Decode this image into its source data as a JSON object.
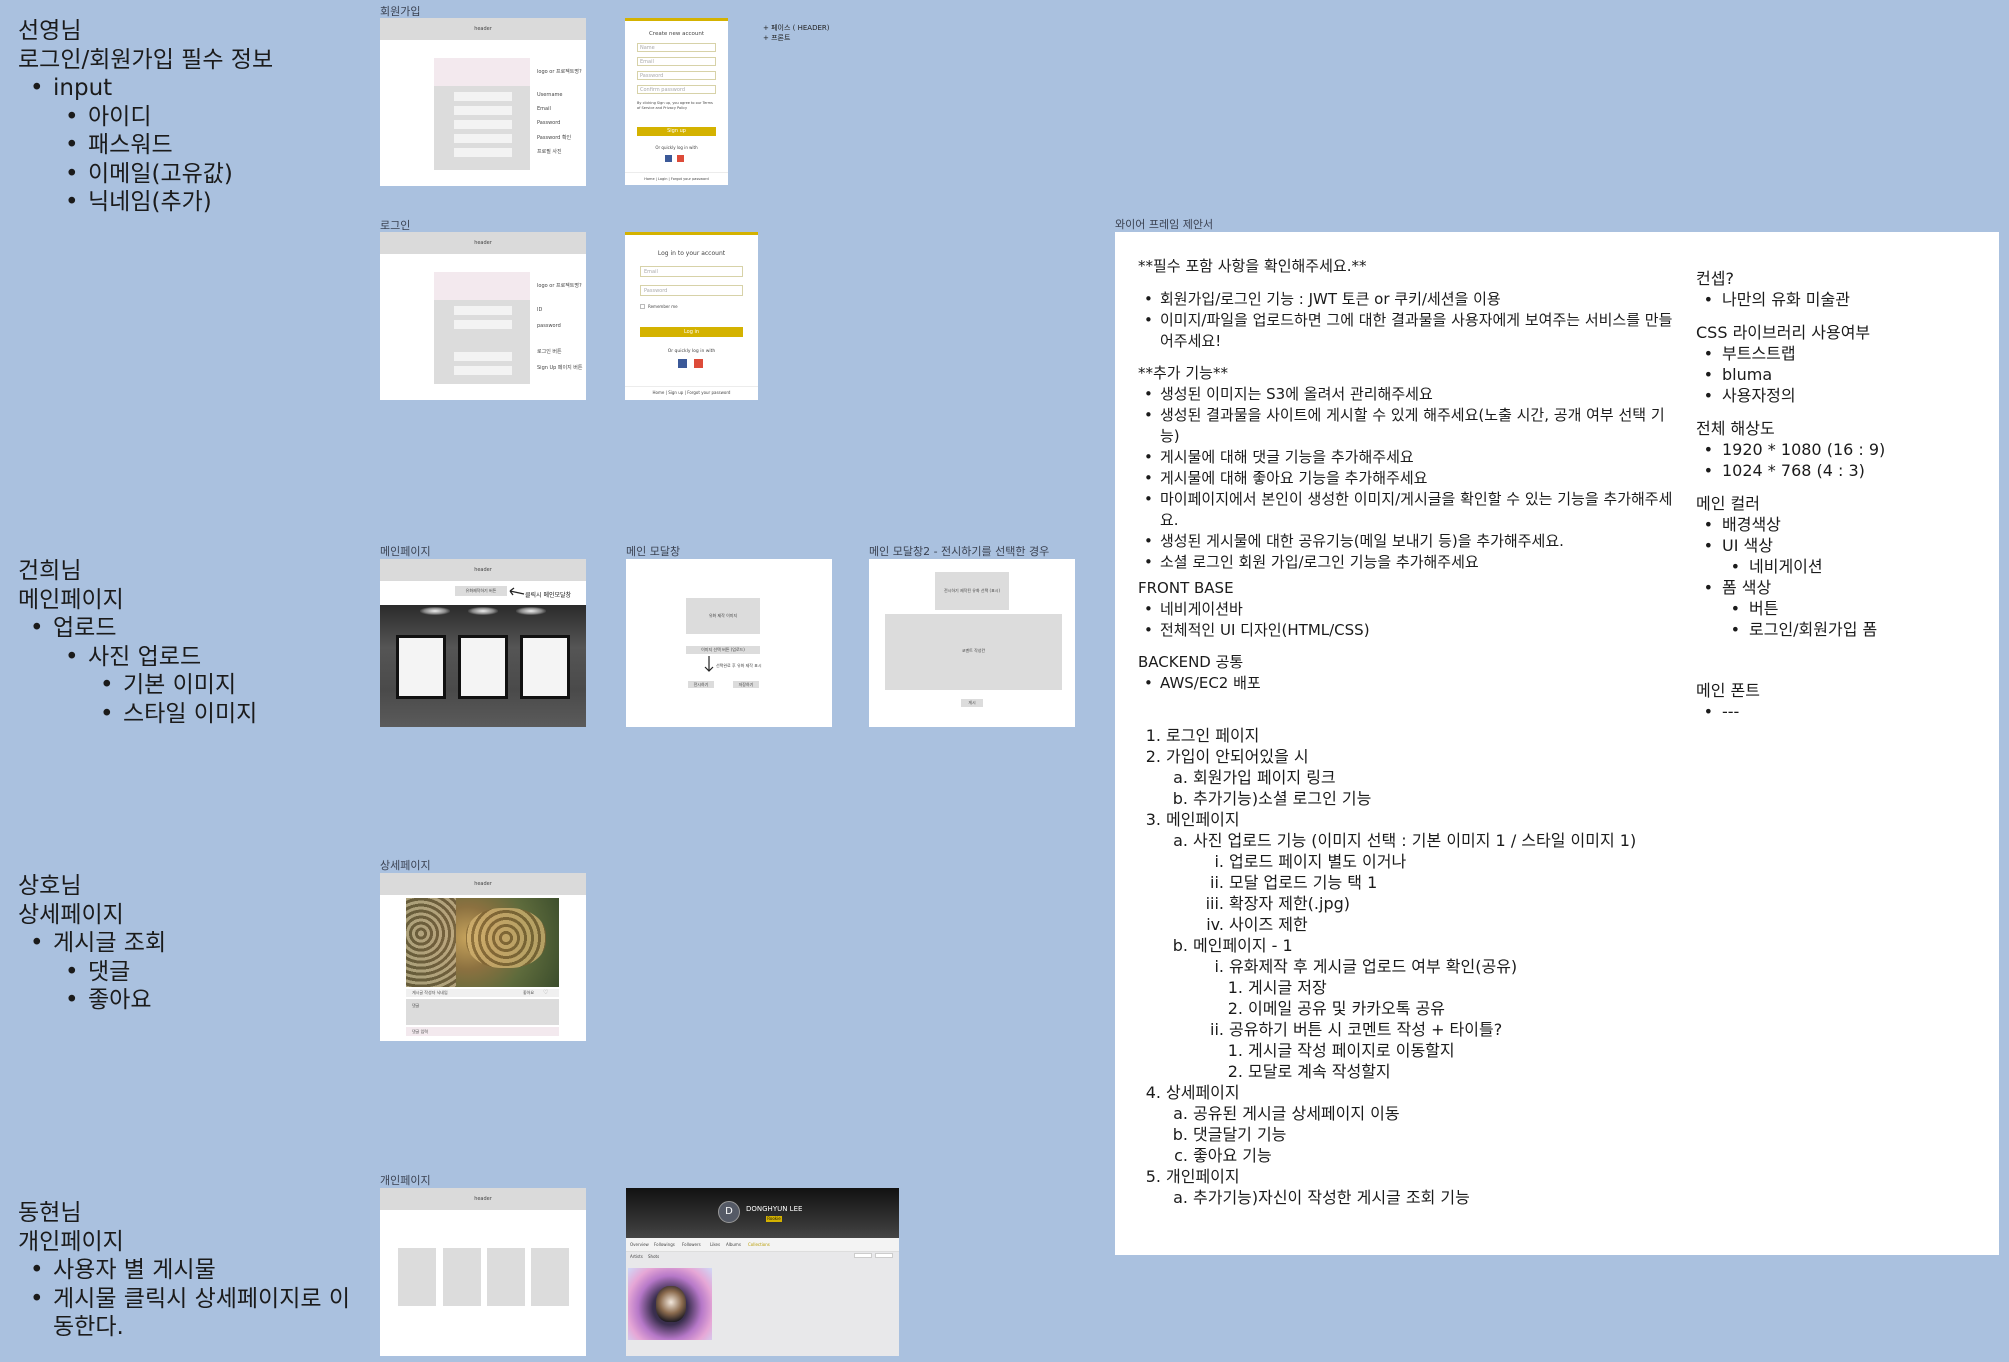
{
  "notes": [
    {
      "name": "선영님",
      "title": "로그인/회원가입 필수 정보",
      "items": [
        {
          "text": "input",
          "children": [
            {
              "text": "아이디"
            },
            {
              "text": "패스워드"
            },
            {
              "text": "이메일(고유값)"
            },
            {
              "text": "닉네임(추가)"
            }
          ]
        }
      ]
    },
    {
      "name": "건희님",
      "title": "메인페이지",
      "items": [
        {
          "text": "업로드",
          "children": [
            {
              "text": "사진 업로드",
              "children": [
                {
                  "text": "기본 이미지"
                },
                {
                  "text": "스타일 이미지"
                }
              ]
            }
          ]
        }
      ]
    },
    {
      "name": "상호님",
      "title": "상세페이지",
      "items": [
        {
          "text": "게시글 조회",
          "children": [
            {
              "text": "댓글"
            },
            {
              "text": "좋아요"
            }
          ]
        }
      ]
    },
    {
      "name": "동현님",
      "title": "개인페이지",
      "items": [
        {
          "text": "사용자 별 게시물"
        },
        {
          "text": "게시물 클릭시 상세페이지로 이동한다."
        }
      ]
    }
  ],
  "frames": {
    "signup": {
      "label": "회원가입",
      "header": "header",
      "side_q": "logo or 프로젝트명?",
      "fields": [
        "Username",
        "Email",
        "Password",
        "Password 확인",
        "프로필 사진"
      ],
      "ref_title": "Create new account",
      "ref_fields": [
        "Name",
        "Email",
        "Password",
        "Confirm password"
      ],
      "ref_terms": "By clicking Sign up, you agree to our Terms of Service and Privacy Policy",
      "ref_button": "Sign up",
      "ref_social": "Or quickly log in with",
      "ref_footer": "Home | Login | Forgot your password"
    },
    "signup_note": [
      "+ 페이스 ( HEADER)",
      "+ 프론트"
    ],
    "login": {
      "label": "로그인",
      "header": "header",
      "side_q": "logo or 프로젝트명?",
      "fields": [
        "ID",
        "password"
      ],
      "links": [
        "로그인 버튼",
        "Sign Up 페이지 버튼"
      ],
      "ref_title": "Log in to your account",
      "ref_fields": [
        "Email",
        "Password"
      ],
      "ref_remember": "Remember me",
      "ref_button": "Log in",
      "ref_social": "Or quickly log in with",
      "ref_footer": "Home | Sign up | Forgot your password"
    },
    "main": {
      "label": "메인페이지",
      "header": "header",
      "upload_button": "유화제작하기 버튼",
      "annotation": "클릭시 메인모달창"
    },
    "modal1": {
      "label": "메인 모달창",
      "box": "유화 제작 이미지",
      "pick": "이미지 선택 버튼 (업로드)",
      "arrow_note": "선택완료 후 유화 제작 표시",
      "btn1": "전시하기",
      "btn2": "저장하기"
    },
    "modal2": {
      "label": "메인 모달창2 - 전시하기를 선택한 경우",
      "box1": "전시하기 제작된 유화 선택 (표시)",
      "box2": "코멘트 작성칸",
      "btn": "게시"
    },
    "detail": {
      "label": "상세페이지",
      "header": "header",
      "caption": "게시글 작성자 닉네임",
      "like": "좋아요",
      "comment": "댓글",
      "comment_input": "댓글 입력"
    },
    "personal": {
      "label": "개인페이지",
      "header": "header"
    },
    "profile": {
      "name": "DONGHYUN LEE",
      "initial": "D",
      "badge": "Rookie",
      "tabs": [
        "Overview",
        "Followings",
        "Followers",
        "Likes",
        "Albums",
        "Collections"
      ],
      "sub_tabs": [
        "Artists",
        "Shots"
      ]
    }
  },
  "doc": {
    "title": "와이어 프레임 제안서",
    "required_heading": "**필수 포함 사항을 확인해주세요.**",
    "required": [
      "회원가입/로그인 기능 : JWT 토큰 or 쿠키/세션을 이용",
      "이미지/파일을 업로드하면 그에 대한 결과물을 사용자에게 보여주는 서비스를 만들어주세요!"
    ],
    "extra_heading": "**추가 기능**",
    "extra": [
      "생성된 이미지는 S3에 올려서 관리해주세요",
      "생성된 결과물을 사이트에 게시할 수 있게 해주세요(노출 시간, 공개 여부 선택 기능)",
      "게시물에 대해 댓글 기능을 추가해주세요",
      "게시물에 대해 좋아요 기능을 추가해주세요",
      "마이페이지에서 본인이 생성한 이미지/게시글을 확인할 수 있는 기능을 추가해주세요.",
      "생성된 게시물에 대한 공유기능(메일 보내기 등)을 추가해주세요.",
      "소셜 로그인 회원 가입/로그인 기능을 추가해주세요"
    ],
    "front_heading": "FRONT BASE",
    "front": [
      "네비게이션바",
      "전체적인 UI 디자인(HTML/CSS)"
    ],
    "backend_heading": "BACKEND 공통",
    "backend": [
      "AWS/EC2 배포"
    ],
    "outline": [
      {
        "m": "1.",
        "t": "로그인 페이지",
        "d": 0
      },
      {
        "m": "2.",
        "t": "가입이 안되어있을 시",
        "d": 0
      },
      {
        "m": "a.",
        "t": "회원가입 페이지 링크",
        "d": 1
      },
      {
        "m": "b.",
        "t": "추가기능)소셜 로그인 기능",
        "d": 1
      },
      {
        "m": "3.",
        "t": "메인페이지",
        "d": 0
      },
      {
        "m": "a.",
        "t": "사진 업로드 기능 (이미지 선택 : 기본 이미지 1 / 스타일 이미지 1)",
        "d": 1
      },
      {
        "m": "i.",
        "t": "업로드 페이지 별도 이거나",
        "d": 2
      },
      {
        "m": "ii.",
        "t": "모달 업로드 기능 택 1",
        "d": 2
      },
      {
        "m": "iii.",
        "t": "확장자 제한(.jpg)",
        "d": 2
      },
      {
        "m": "iv.",
        "t": "사이즈 제한",
        "d": 2
      },
      {
        "m": "b.",
        "t": "메인페이지 - 1",
        "d": 1
      },
      {
        "m": "i.",
        "t": "유화제작 후 게시글 업로드 여부 확인(공유)",
        "d": 2
      },
      {
        "m": "1.",
        "t": "게시글 저장",
        "d": 3
      },
      {
        "m": "2.",
        "t": "이메일 공유 및 카카오톡 공유",
        "d": 3
      },
      {
        "m": "ii.",
        "t": "공유하기 버튼 시 코멘트 작성 + 타이틀?",
        "d": 2
      },
      {
        "m": "1.",
        "t": "게시글 작성 페이지로 이동할지",
        "d": 3
      },
      {
        "m": "2.",
        "t": "모달로 계속 작성할지",
        "d": 3
      },
      {
        "m": "4.",
        "t": "상세페이지",
        "d": 0
      },
      {
        "m": "a.",
        "t": "공유된 게시글 상세페이지 이동",
        "d": 1
      },
      {
        "m": "b.",
        "t": "댓글달기 기능",
        "d": 1
      },
      {
        "m": "c.",
        "t": "좋아요 기능",
        "d": 1
      },
      {
        "m": "5.",
        "t": "개인페이지",
        "d": 0
      },
      {
        "m": "a.",
        "t": "추가기능)자신이 작성한 게시글 조회 기능",
        "d": 1
      }
    ],
    "right": [
      {
        "heading": "컨셉?",
        "items": [
          {
            "t": "나만의 유화 미술관",
            "d": 0
          }
        ]
      },
      {
        "heading": "CSS 라이브러리 사용여부",
        "items": [
          {
            "t": "부트스트랩",
            "d": 0
          },
          {
            "t": "bluma",
            "d": 0
          },
          {
            "t": "사용자정의",
            "d": 0
          }
        ]
      },
      {
        "heading": "전체 해상도",
        "items": [
          {
            "t": "1920 * 1080 (16 : 9)",
            "d": 0
          },
          {
            "t": "1024 * 768 (4 : 3)",
            "d": 0
          }
        ]
      },
      {
        "heading": "메인 컬러",
        "items": [
          {
            "t": "배경색상",
            "d": 0
          },
          {
            "t": "UI 색상",
            "d": 0
          },
          {
            "t": "네비게이션",
            "d": 1
          },
          {
            "t": "폼 색상",
            "d": 0
          },
          {
            "t": "버튼",
            "d": 1
          },
          {
            "t": "로그인/회원가입 폼",
            "d": 1
          }
        ]
      },
      {
        "heading": "메인 폰트",
        "items": [
          {
            "t": "---",
            "d": 0
          }
        ]
      }
    ]
  }
}
